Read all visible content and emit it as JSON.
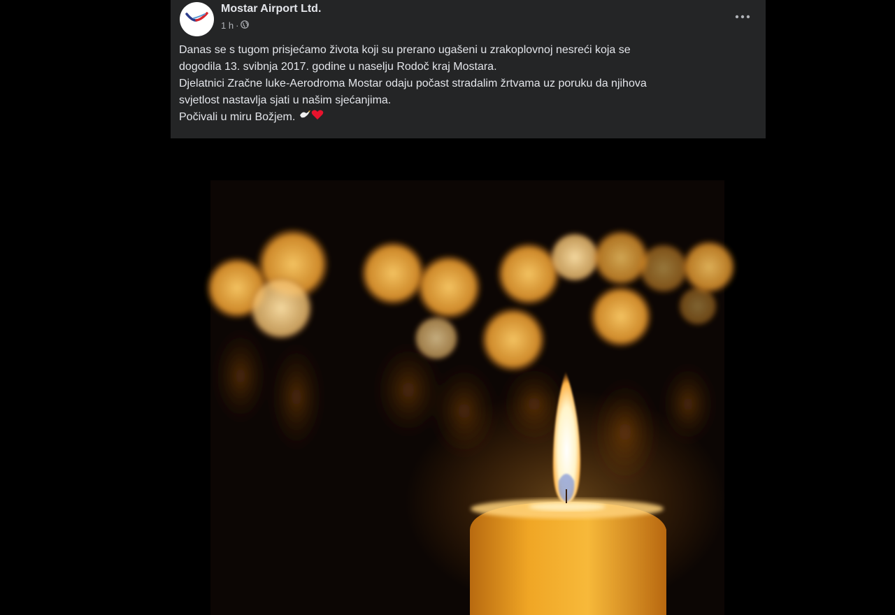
{
  "post": {
    "page_name": "Mostar Airport Ltd.",
    "time": "1 h",
    "separator": "·",
    "audience_icon": "globe-icon",
    "more_icon": "more-options-icon",
    "text_lines": [
      "Danas se s tugom prisjećamo života koji su prerano ugašeni u zrakoplovnoj nesreći koja se",
      "dogodila 13. svibnja 2017. godine u naselju Rodoč kraj Mostara.",
      "Djelatnici Zračne luke-Aerodroma Mostar odaju počast stradalim žrtvama uz poruku da njihova",
      "svjetlost nastavlja sjati u našim sjećanjima.",
      "Počivali u miru Božjem."
    ],
    "emojis": [
      "dove-icon",
      "red-heart-icon"
    ]
  },
  "colors": {
    "card": "#242526",
    "text": "#e4e6eb",
    "secondary_text": "#b0b3b8",
    "candle": "#f2a81f"
  },
  "image": {
    "subject": "candle-photo"
  }
}
